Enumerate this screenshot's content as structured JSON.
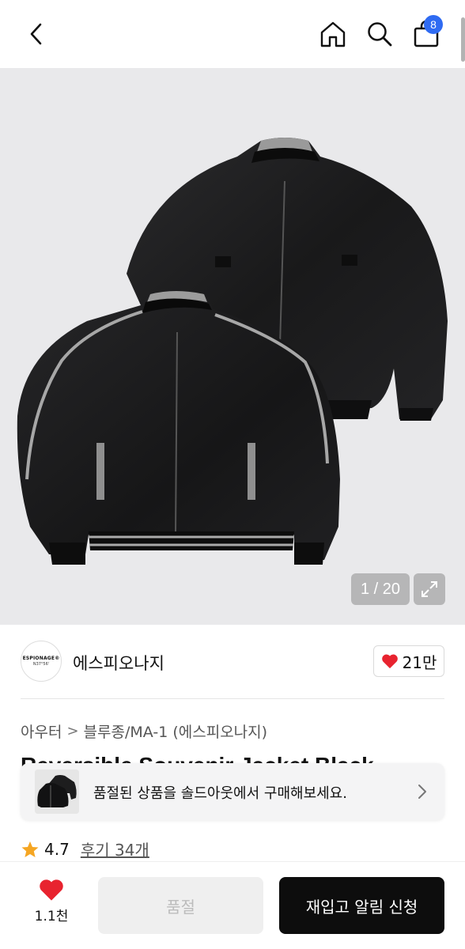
{
  "header": {
    "back_icon": "chevron-left-icon",
    "home_icon": "home-icon",
    "search_icon": "search-icon",
    "cart_icon": "shopping-bag-icon",
    "cart_count": "8",
    "badge_color": "#2f6bf2"
  },
  "gallery": {
    "counter": "1 / 20",
    "expand_icon": "expand-icon"
  },
  "brand": {
    "logo_text": "ESPIONAGE®",
    "logo_subtext": "N37°56'",
    "name": "에스피오나지",
    "like_count": "21만",
    "heart_color": "#e8232f"
  },
  "breadcrumb": {
    "items": [
      "아우터",
      "블루종/MA-1 (에스피오나지)"
    ],
    "separator": ">"
  },
  "product": {
    "title": "Reversible Souvenir Jacket Black"
  },
  "rating": {
    "value": "4.7",
    "reviews": "후기 34개",
    "star_color": "#f5a623"
  },
  "soldout_banner": {
    "text": "품절된 상품을 솔드아웃에서 구매해보세요."
  },
  "bottom_bar": {
    "wish_count": "1.1천",
    "soldout_label": "품절",
    "restock_label": "재입고 알림 신청"
  }
}
